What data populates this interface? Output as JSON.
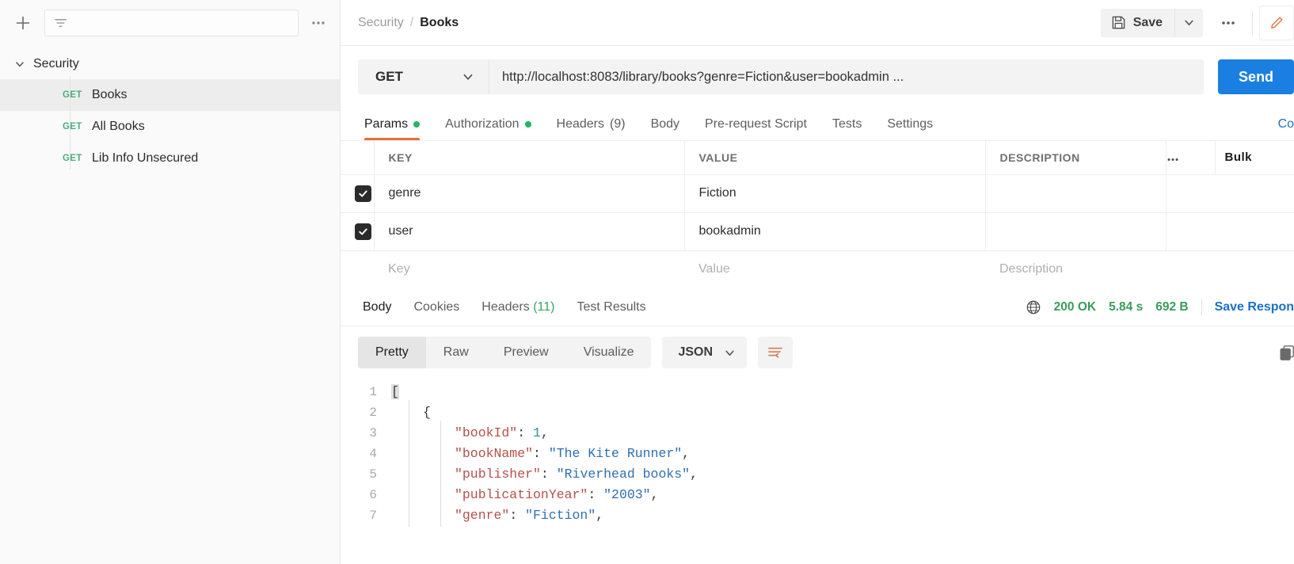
{
  "sidebar": {
    "add_icon": "plus-icon",
    "filter_icon": "filter-icon",
    "more_icon": "ellipsis-icon",
    "search_placeholder": "",
    "folder": {
      "label": "Security",
      "expanded": true
    },
    "requests": [
      {
        "method": "GET",
        "label": "Books",
        "active": true
      },
      {
        "method": "GET",
        "label": "All Books",
        "active": false
      },
      {
        "method": "GET",
        "label": "Lib Info Unsecured",
        "active": false
      }
    ]
  },
  "header": {
    "breadcrumb_parent": "Security",
    "breadcrumb_sep": "/",
    "breadcrumb_current": "Books",
    "save_label": "Save",
    "save_icon": "floppy-disk-icon",
    "save_caret_icon": "chevron-down-icon",
    "more_icon": "ellipsis-icon",
    "edit_icon": "pencil-icon",
    "edit_icon_color": "#e8703a"
  },
  "request": {
    "method": "GET",
    "method_caret_icon": "chevron-down-icon",
    "url": "http://localhost:8083/library/books?genre=Fiction&user=bookadmin ...",
    "send_label": "Send",
    "send_color": "#1a7fe0"
  },
  "request_tabs": [
    {
      "label": "Params",
      "dot": true,
      "count": "",
      "active": true
    },
    {
      "label": "Authorization",
      "dot": true,
      "count": "",
      "active": false
    },
    {
      "label": "Headers",
      "dot": false,
      "count": "(9)",
      "active": false
    },
    {
      "label": "Body",
      "dot": false,
      "count": "",
      "active": false
    },
    {
      "label": "Pre-request Script",
      "dot": false,
      "count": "",
      "active": false
    },
    {
      "label": "Tests",
      "dot": false,
      "count": "",
      "active": false
    },
    {
      "label": "Settings",
      "dot": false,
      "count": "",
      "active": false
    }
  ],
  "cookies_link": "Co",
  "params": {
    "headers": {
      "key": "KEY",
      "value": "VALUE",
      "description": "DESCRIPTION"
    },
    "more_icon": "ellipsis-icon",
    "bulk_label": "Bulk",
    "rows": [
      {
        "checked": true,
        "key": "genre",
        "value": "Fiction",
        "description": ""
      },
      {
        "checked": true,
        "key": "user",
        "value": "bookadmin",
        "description": ""
      }
    ],
    "placeholder_row": {
      "key": "Key",
      "value": "Value",
      "description": "Description"
    }
  },
  "response_tabs": [
    {
      "label": "Body",
      "count": "",
      "active": true
    },
    {
      "label": "Cookies",
      "count": "",
      "active": false
    },
    {
      "label": "Headers",
      "count": "(11)",
      "active": false
    },
    {
      "label": "Test Results",
      "count": "",
      "active": false
    }
  ],
  "response_status": {
    "globe_icon": "globe-icon",
    "status": "200 OK",
    "time": "5.84 s",
    "size": "692 B",
    "save_response": "Save Respon",
    "status_color": "#3a9b5c"
  },
  "body_toolbar": {
    "formats": [
      {
        "label": "Pretty",
        "active": true
      },
      {
        "label": "Raw",
        "active": false
      },
      {
        "label": "Preview",
        "active": false
      },
      {
        "label": "Visualize",
        "active": false
      }
    ],
    "language": "JSON",
    "language_caret_icon": "chevron-down-icon",
    "wrap_icon": "word-wrap-icon",
    "copy_icon": "copy-icon"
  },
  "body_code": {
    "language": "json",
    "lines": [
      {
        "n": "1",
        "indent": 0,
        "tokens": [
          {
            "t": "[",
            "c": "pun-hl"
          }
        ]
      },
      {
        "n": "2",
        "indent": 1,
        "tokens": [
          {
            "t": "{",
            "c": "pun"
          }
        ]
      },
      {
        "n": "3",
        "indent": 2,
        "tokens": [
          {
            "t": "\"bookId\"",
            "c": "key"
          },
          {
            "t": ": ",
            "c": "pun"
          },
          {
            "t": "1",
            "c": "num"
          },
          {
            "t": ",",
            "c": "pun"
          }
        ]
      },
      {
        "n": "4",
        "indent": 2,
        "tokens": [
          {
            "t": "\"bookName\"",
            "c": "key"
          },
          {
            "t": ": ",
            "c": "pun"
          },
          {
            "t": "\"The Kite Runner\"",
            "c": "str"
          },
          {
            "t": ",",
            "c": "pun"
          }
        ]
      },
      {
        "n": "5",
        "indent": 2,
        "tokens": [
          {
            "t": "\"publisher\"",
            "c": "key"
          },
          {
            "t": ": ",
            "c": "pun"
          },
          {
            "t": "\"Riverhead books\"",
            "c": "str"
          },
          {
            "t": ",",
            "c": "pun"
          }
        ]
      },
      {
        "n": "6",
        "indent": 2,
        "tokens": [
          {
            "t": "\"publicationYear\"",
            "c": "key"
          },
          {
            "t": ": ",
            "c": "pun"
          },
          {
            "t": "\"2003\"",
            "c": "str"
          },
          {
            "t": ",",
            "c": "pun"
          }
        ]
      },
      {
        "n": "7",
        "indent": 2,
        "tokens": [
          {
            "t": "\"genre\"",
            "c": "key"
          },
          {
            "t": ": ",
            "c": "pun"
          },
          {
            "t": "\"Fiction\"",
            "c": "str"
          },
          {
            "t": ",",
            "c": "pun"
          }
        ]
      }
    ]
  }
}
